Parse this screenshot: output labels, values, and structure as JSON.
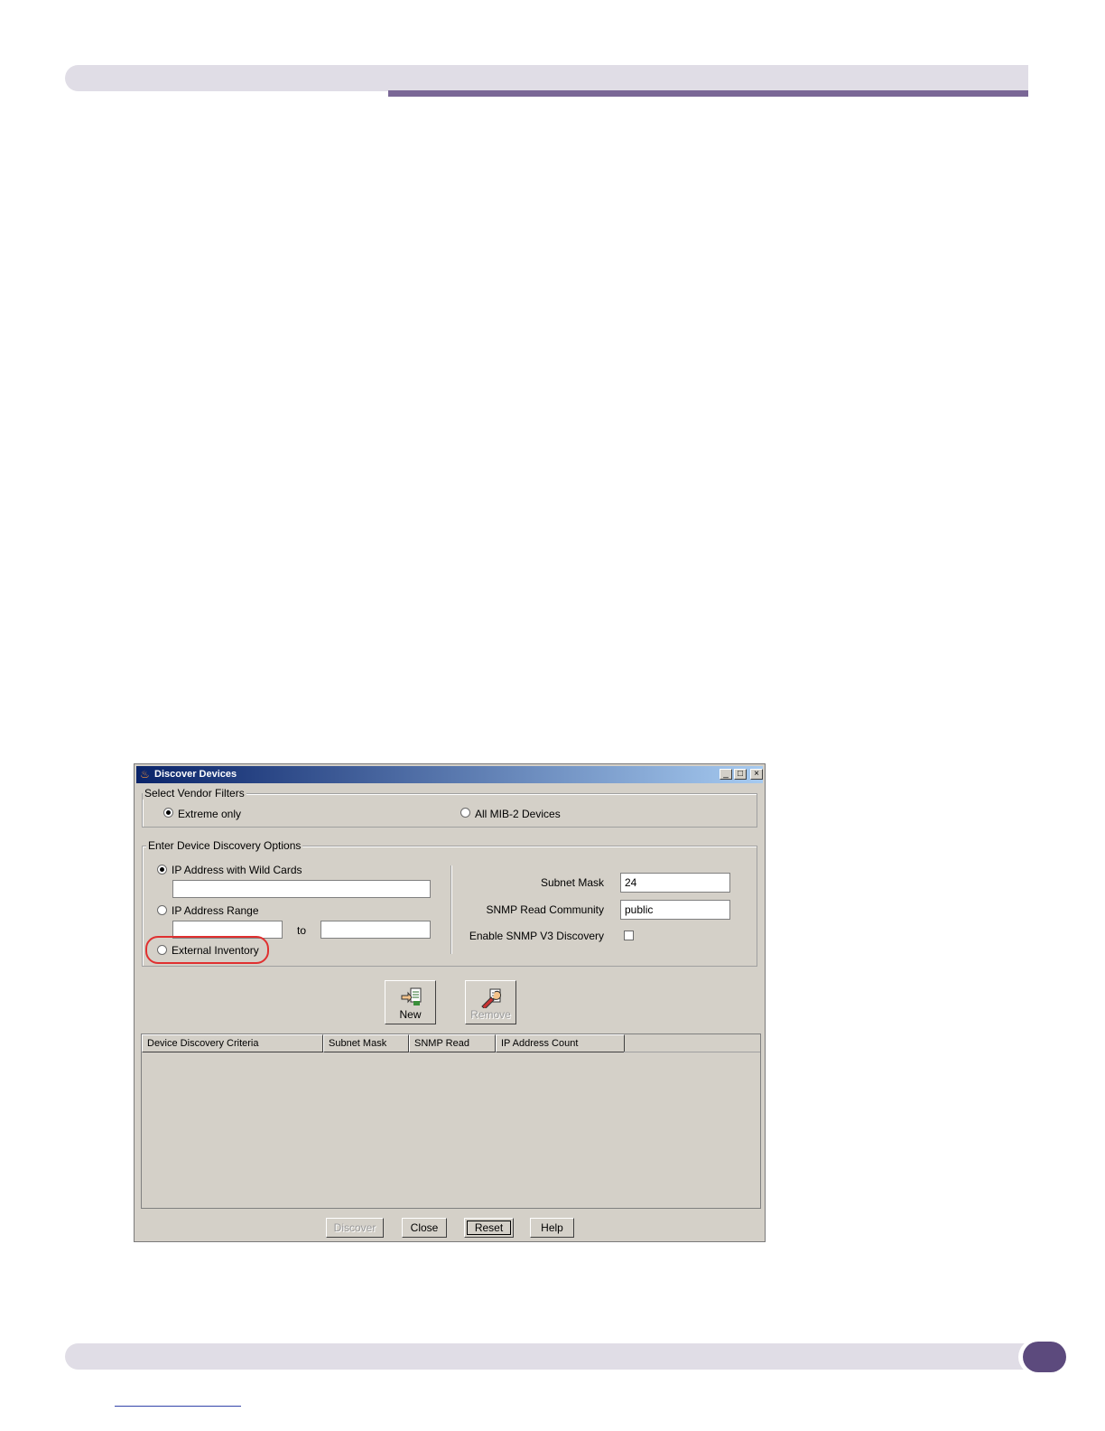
{
  "dialog": {
    "title": "Discover Devices",
    "window_controls": {
      "minimize": "_",
      "maximize": "□",
      "close": "×"
    }
  },
  "vendor_filters": {
    "legend": "Select Vendor Filters",
    "options": [
      {
        "label": "Extreme only",
        "selected": true
      },
      {
        "label": "All MIB-2 Devices",
        "selected": false
      }
    ]
  },
  "discovery_options": {
    "legend": "Enter Device Discovery Options",
    "ip_wildcard": {
      "label": "IP Address with Wild Cards",
      "selected": true,
      "value": ""
    },
    "ip_range": {
      "label": "IP Address Range",
      "selected": false,
      "from": "",
      "to_label": "to",
      "to": ""
    },
    "external_inventory": {
      "label": "External Inventory",
      "selected": false
    },
    "subnet_mask": {
      "label": "Subnet Mask",
      "value": "24"
    },
    "snmp_read_community": {
      "label": "SNMP Read Community",
      "value": "public"
    },
    "snmp_v3": {
      "label": "Enable SNMP V3 Discovery",
      "checked": false
    }
  },
  "actions": {
    "new_label": "New",
    "remove_label": "Remove"
  },
  "table": {
    "columns": [
      "Device Discovery Criteria",
      "Subnet Mask",
      "SNMP Read",
      "IP Address Count"
    ],
    "rows": []
  },
  "buttons": {
    "discover": "Discover",
    "close": "Close",
    "reset": "Reset",
    "help": "Help"
  },
  "colors": {
    "title_gradient_start": "#0a246a",
    "title_gradient_end": "#a6caf0",
    "dialog_bg": "#d4d0c8",
    "highlight": "#e03030",
    "header_accent": "#7a6796",
    "footer_dot": "#5c4a7d"
  }
}
